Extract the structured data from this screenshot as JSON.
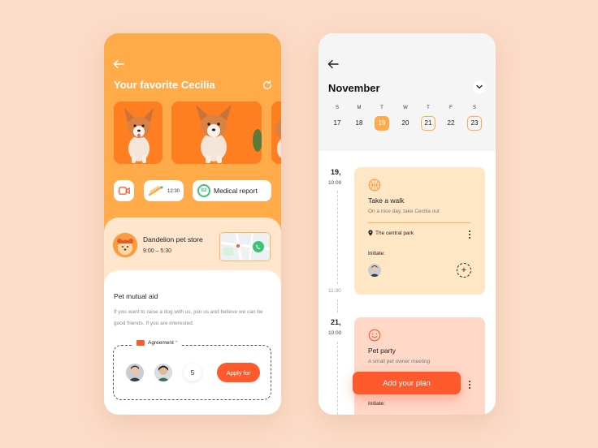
{
  "colors": {
    "background": "#fbdcc8",
    "primary_orange": "#ffab4a",
    "accent_red": "#ff5a2e",
    "light_peach": "#ffe6cd",
    "green": "#3ec276"
  },
  "left_screen": {
    "back_icon": "arrow-left-icon",
    "title": "Your favorite Cecilia",
    "refresh_icon": "refresh-icon",
    "actions": {
      "video_icon": "video-camera-icon",
      "feed_icon": "feeding-icon",
      "feed_time": "12:30",
      "medical_score": "82",
      "medical_label": "Medical report"
    },
    "store": {
      "name": "Dandelion pet store",
      "hours": "9:00 – 5:30",
      "call_icon": "phone-icon"
    },
    "aid": {
      "title": "Pet mutual aid",
      "description": "If you want to raise a dog with us, join us and believe we can be good friends. If you are interested.",
      "agreement_label": "Agreement",
      "required_mark": "*",
      "participant_count": "5",
      "apply_label": "Apply for"
    }
  },
  "right_screen": {
    "back_icon": "arrow-left-icon",
    "month": "November",
    "dropdown_icon": "chevron-down-icon",
    "weekdays": [
      "S",
      "M",
      "T",
      "W",
      "T",
      "F",
      "S"
    ],
    "days": [
      "17",
      "18",
      "19",
      "20",
      "21",
      "22",
      "23"
    ],
    "selected_day": "19",
    "marked_days": [
      "21",
      "23"
    ],
    "events": [
      {
        "date": "19,",
        "start": "10:00",
        "end": "11:30",
        "icon": "basketball-icon",
        "title": "Take a walk",
        "subtitle": "On a nice day, take Cecilia out",
        "location": "The central park",
        "initiate_label": "Initiate:"
      },
      {
        "date": "21,",
        "start": "10:00",
        "icon": "smiley-icon",
        "title": "Pet party",
        "subtitle": "A small pet owner meeting",
        "initiate_label": "Initiate:"
      }
    ],
    "add_plan_label": "Add your plan"
  }
}
